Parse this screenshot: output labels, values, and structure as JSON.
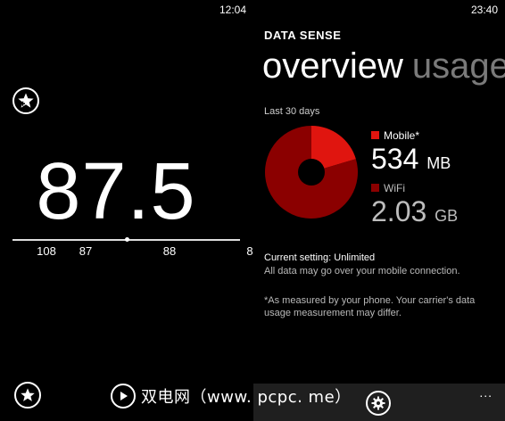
{
  "radio": {
    "status_time": "12:04",
    "frequency": "87.5",
    "ticks": [
      "108",
      "87",
      "88",
      "8"
    ],
    "favorite_icon": "add-favorite-star-icon",
    "favorites_icon": "favorites-star-icon"
  },
  "data_sense": {
    "status_time": "23:40",
    "app_title": "DATA SENSE",
    "pivot_active": "overview",
    "pivot_next": "usage",
    "period": "Last 30 days",
    "legend": [
      {
        "label": "Mobile*",
        "amount": "534",
        "unit": "MB",
        "color": "#e0150f"
      },
      {
        "label": "WiFi",
        "amount": "2.03",
        "unit": "GB",
        "color": "#8b0000"
      }
    ],
    "current_setting": "Current setting: Unlimited",
    "setting_note": "All data may go over your mobile connection.",
    "footnote": "*As measured by your phone. Your carrier's data usage measurement may differ.",
    "appbar": {
      "settings_icon": "settings-gear-icon",
      "more": "..."
    },
    "chart_data": {
      "type": "pie",
      "categories": [
        "Mobile*",
        "WiFi"
      ],
      "values": [
        534,
        2080
      ],
      "colors": [
        "#e0150f",
        "#8b0000"
      ]
    }
  },
  "watermark": {
    "play_icon": "play-icon",
    "text": "双电网（www. pcpc. me）"
  }
}
